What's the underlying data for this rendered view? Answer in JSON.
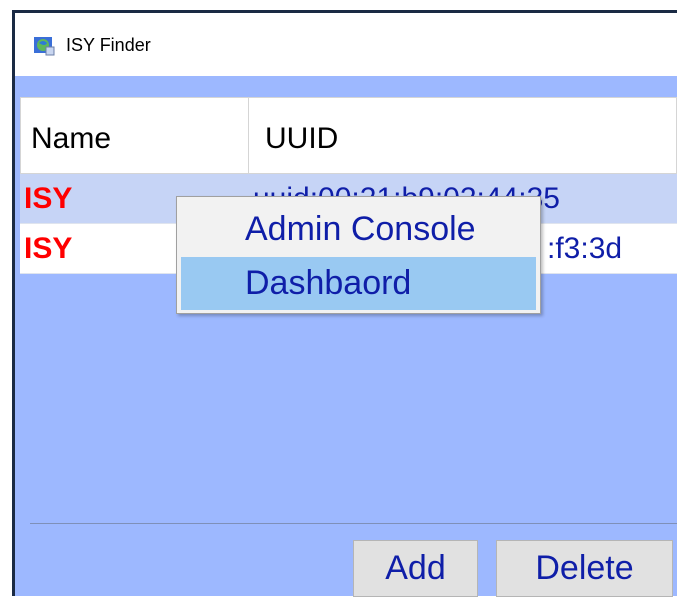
{
  "window": {
    "title": "ISY Finder",
    "icon": "globe-app-icon"
  },
  "table": {
    "columns": [
      "Name",
      "UUID"
    ],
    "rows": [
      {
        "name": "ISY",
        "uuid": "uuid:00:21:b9:02:44:35",
        "selected": true
      },
      {
        "name": "ISY",
        "uuid": ":f3:3d",
        "selected": false
      }
    ]
  },
  "context_menu": {
    "items": [
      {
        "label": "Admin Console",
        "highlighted": false
      },
      {
        "label": "Dashbaord",
        "highlighted": true
      }
    ]
  },
  "buttons": {
    "add": "Add",
    "delete": "Delete"
  },
  "colors": {
    "accent_name": "#ff0000",
    "text_blue": "#0f1ea8",
    "window_bg": "#9db8ff",
    "row_selected": "#c6d4f6",
    "menu_highlight": "#99c9f2"
  }
}
